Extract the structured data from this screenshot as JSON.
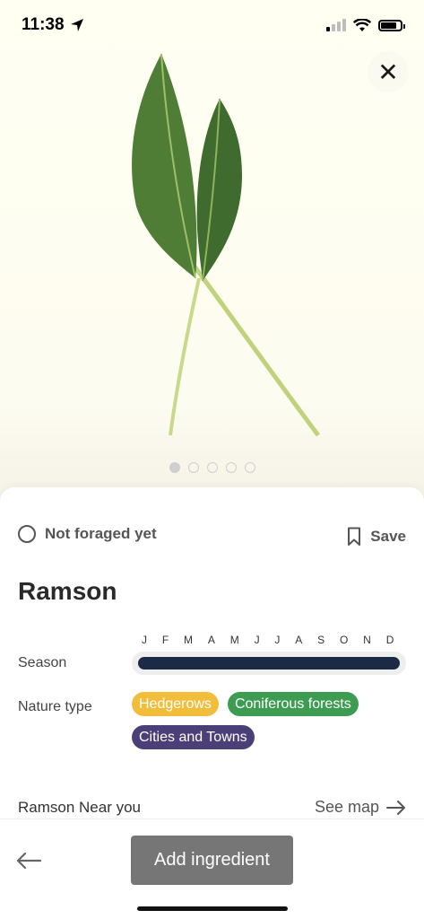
{
  "status_bar": {
    "time": "11:38",
    "location_icon": "location-arrow-icon",
    "signal_icon": "cellular-signal-icon",
    "wifi_icon": "wifi-icon",
    "battery_icon": "battery-icon",
    "battery_level": 0.8
  },
  "hero": {
    "close_icon": "close-icon",
    "image_subject": "ramson leaves",
    "carousel": {
      "total": 5,
      "active_index": 0
    }
  },
  "plant": {
    "foraged_status": "Not foraged yet",
    "save_label": "Save",
    "name": "Ramson",
    "season_label": "Season",
    "months": [
      "J",
      "F",
      "M",
      "A",
      "M",
      "J",
      "J",
      "A",
      "S",
      "O",
      "N",
      "D"
    ],
    "season_segments": [
      {
        "from_month": 1,
        "to_month": 4
      },
      {
        "from_month": 4,
        "to_month": 12
      }
    ],
    "nature_type_label": "Nature type",
    "nature_types": [
      {
        "label": "Hedgerows",
        "color": "#f1bd3a"
      },
      {
        "label": "Coniferous forests",
        "color": "#3e9b52"
      },
      {
        "label": "Cities and Towns",
        "color": "#4b3f78"
      }
    ],
    "near_you_label": "Ramson Near you",
    "see_map_label": "See map"
  },
  "bottom_bar": {
    "back_icon": "arrow-left-icon",
    "add_ingredient_label": "Add ingredient"
  },
  "colors": {
    "season_bar": "#1b2a45",
    "button_gray": "#767676"
  }
}
